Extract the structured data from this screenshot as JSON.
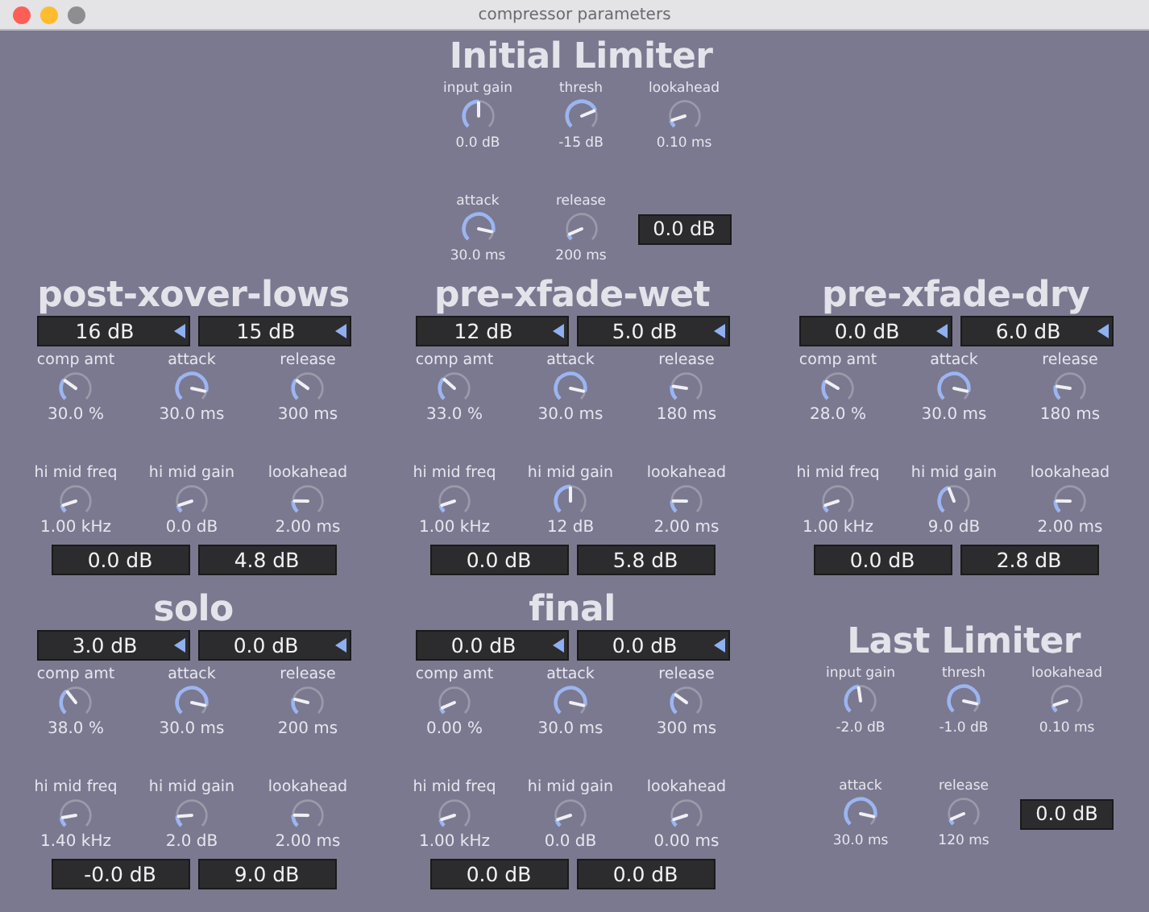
{
  "window": {
    "title": "compressor parameters"
  },
  "initial_limiter": {
    "title": "Initial Limiter",
    "knobs": [
      {
        "label": "input gain",
        "value": "0.0 dB"
      },
      {
        "label": "thresh",
        "value": "-15 dB"
      },
      {
        "label": "lookahead",
        "value": "0.10 ms"
      },
      {
        "label": "attack",
        "value": "30.0 ms"
      },
      {
        "label": "release",
        "value": "200 ms"
      }
    ],
    "output": "0.0 dB"
  },
  "compressors": [
    {
      "title": "post-xover-lows",
      "thresholds": [
        "16 dB",
        "15 dB"
      ],
      "knobs": [
        {
          "label": "comp amt",
          "value": "30.0 %"
        },
        {
          "label": "attack",
          "value": "30.0 ms"
        },
        {
          "label": "release",
          "value": "300 ms"
        },
        {
          "label": "hi mid freq",
          "value": "1.00 kHz"
        },
        {
          "label": "hi mid gain",
          "value": "0.0 dB"
        },
        {
          "label": "lookahead",
          "value": "2.00 ms"
        }
      ],
      "outputs": [
        "0.0 dB",
        "4.8 dB"
      ]
    },
    {
      "title": "pre-xfade-wet",
      "thresholds": [
        "12 dB",
        "5.0 dB"
      ],
      "knobs": [
        {
          "label": "comp amt",
          "value": "33.0 %"
        },
        {
          "label": "attack",
          "value": "30.0 ms"
        },
        {
          "label": "release",
          "value": "180 ms"
        },
        {
          "label": "hi mid freq",
          "value": "1.00 kHz"
        },
        {
          "label": "hi mid gain",
          "value": "12 dB"
        },
        {
          "label": "lookahead",
          "value": "2.00 ms"
        }
      ],
      "outputs": [
        "0.0 dB",
        "5.8 dB"
      ]
    },
    {
      "title": "pre-xfade-dry",
      "thresholds": [
        "0.0 dB",
        "6.0 dB"
      ],
      "knobs": [
        {
          "label": "comp amt",
          "value": "28.0 %"
        },
        {
          "label": "attack",
          "value": "30.0 ms"
        },
        {
          "label": "release",
          "value": "180 ms"
        },
        {
          "label": "hi mid freq",
          "value": "1.00 kHz"
        },
        {
          "label": "hi mid gain",
          "value": "9.0 dB"
        },
        {
          "label": "lookahead",
          "value": "2.00 ms"
        }
      ],
      "outputs": [
        "0.0 dB",
        "2.8 dB"
      ]
    },
    {
      "title": "solo",
      "thresholds": [
        "3.0 dB",
        "0.0 dB"
      ],
      "knobs": [
        {
          "label": "comp amt",
          "value": "38.0 %"
        },
        {
          "label": "attack",
          "value": "30.0 ms"
        },
        {
          "label": "release",
          "value": "200 ms"
        },
        {
          "label": "hi mid freq",
          "value": "1.40 kHz"
        },
        {
          "label": "hi mid gain",
          "value": "2.0 dB"
        },
        {
          "label": "lookahead",
          "value": "2.00 ms"
        }
      ],
      "outputs": [
        "-0.0 dB",
        "9.0 dB"
      ]
    },
    {
      "title": "final",
      "thresholds": [
        "0.0 dB",
        "0.0 dB"
      ],
      "knobs": [
        {
          "label": "comp amt",
          "value": "0.00 %"
        },
        {
          "label": "attack",
          "value": "30.0 ms"
        },
        {
          "label": "release",
          "value": "300 ms"
        },
        {
          "label": "hi mid freq",
          "value": "1.00 kHz"
        },
        {
          "label": "hi mid gain",
          "value": "0.0 dB"
        },
        {
          "label": "lookahead",
          "value": "0.00 ms"
        }
      ],
      "outputs": [
        "0.0 dB",
        "0.0 dB"
      ]
    }
  ],
  "last_limiter": {
    "title": "Last Limiter",
    "knobs": [
      {
        "label": "input gain",
        "value": "-2.0 dB"
      },
      {
        "label": "thresh",
        "value": "-1.0 dB"
      },
      {
        "label": "lookahead",
        "value": "0.10 ms"
      },
      {
        "label": "attack",
        "value": "30.0 ms"
      },
      {
        "label": "release",
        "value": "120 ms"
      }
    ],
    "output": "0.0 dB"
  }
}
